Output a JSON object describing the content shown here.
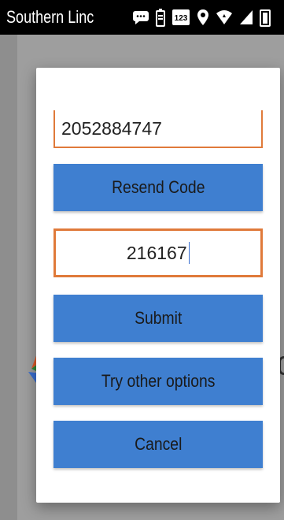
{
  "status_bar": {
    "carrier": "Southern Linc",
    "icons": [
      "message-icon",
      "battery-saver-icon",
      "keypad-123-icon",
      "location-icon",
      "wifi-icon",
      "signal-icon",
      "battery-icon"
    ],
    "keypad_badge": "123"
  },
  "dialog": {
    "phone_value": "2052884747",
    "resend_label": "Resend Code",
    "code_value": "216167",
    "submit_label": "Submit",
    "other_options_label": "Try other options",
    "cancel_label": "Cancel"
  },
  "colors": {
    "button_bg": "#3f7fd0",
    "field_border": "#e07a3a",
    "overlay": "#9e9e9e"
  }
}
